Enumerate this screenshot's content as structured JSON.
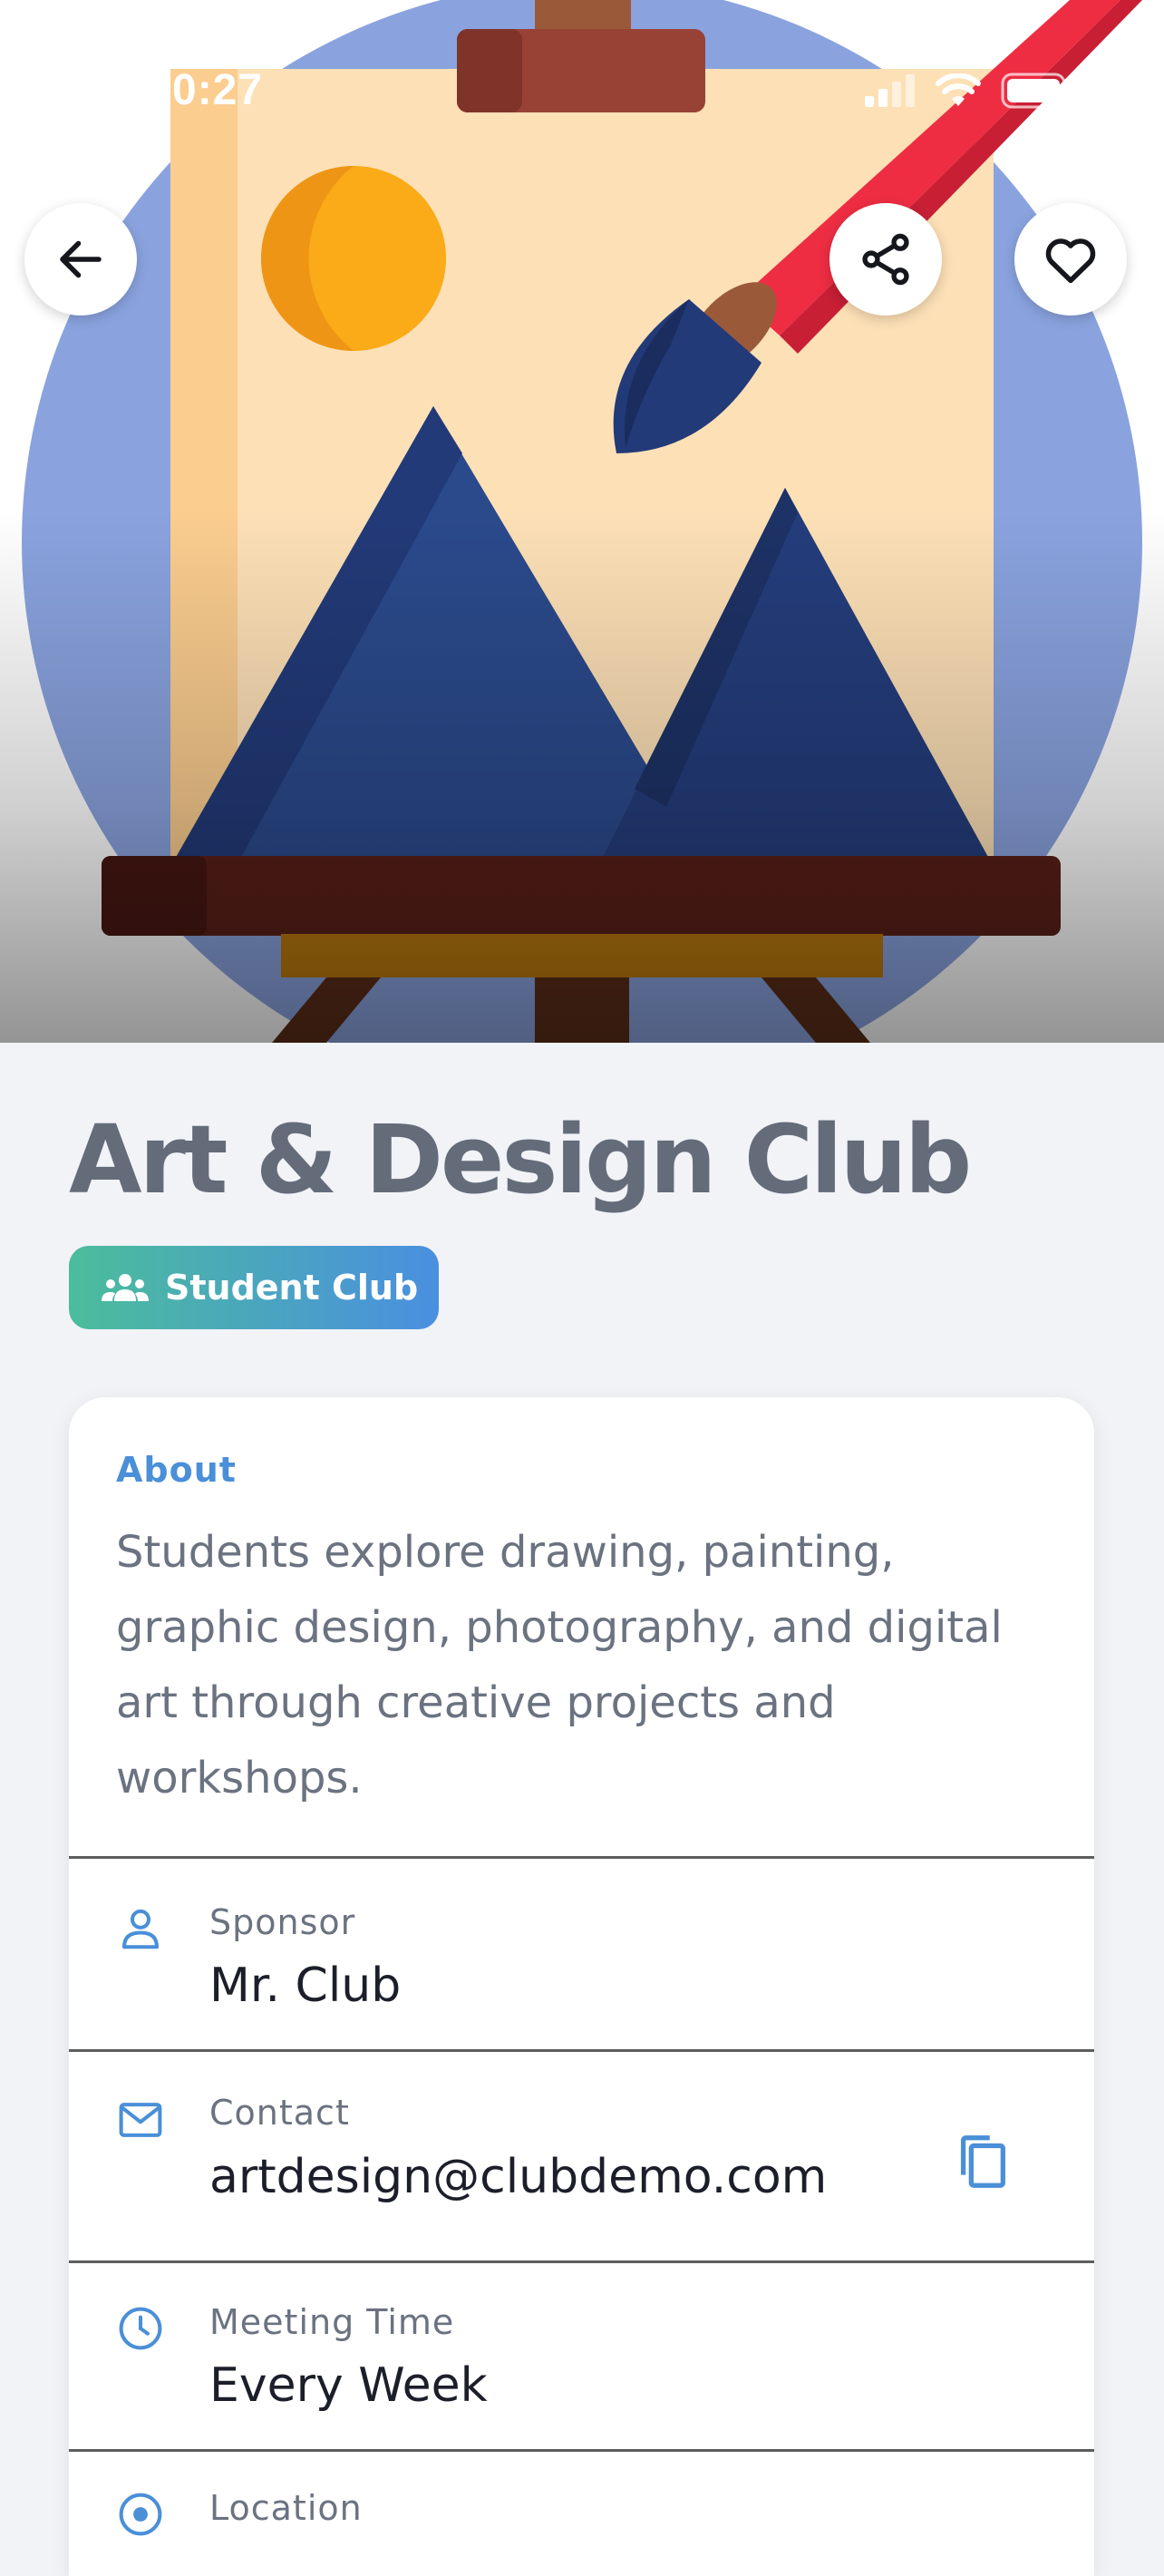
{
  "status_bar": {
    "time": "0:27"
  },
  "hero": {
    "icons": {
      "back": "arrow-left-icon",
      "share": "share-icon",
      "favorite": "heart-icon"
    }
  },
  "club": {
    "name": "Art & Design Club",
    "badge": "Student Club",
    "badge_icon": "group-icon"
  },
  "about": {
    "label": "About",
    "description": "Students explore drawing, painting, graphic design, photography, and digital art through creative projects and workshops."
  },
  "details": [
    {
      "label": "Sponsor",
      "value": "Mr. Club",
      "icon": "person-icon"
    },
    {
      "label": "Contact",
      "value": "artdesign@clubdemo.com",
      "icon": "mail-icon",
      "action_icon": "copy-icon"
    },
    {
      "label": "Meeting Time",
      "value": "Every Week",
      "icon": "clock-icon"
    },
    {
      "label": "Location",
      "value": "",
      "icon": "location-pin-icon"
    }
  ],
  "colors": {
    "accent": "#4a8fd8",
    "badge_start": "#4bbd9b",
    "badge_end": "#4a8fe0",
    "title": "#646c7a",
    "page_bg": "#f1f3f7"
  }
}
